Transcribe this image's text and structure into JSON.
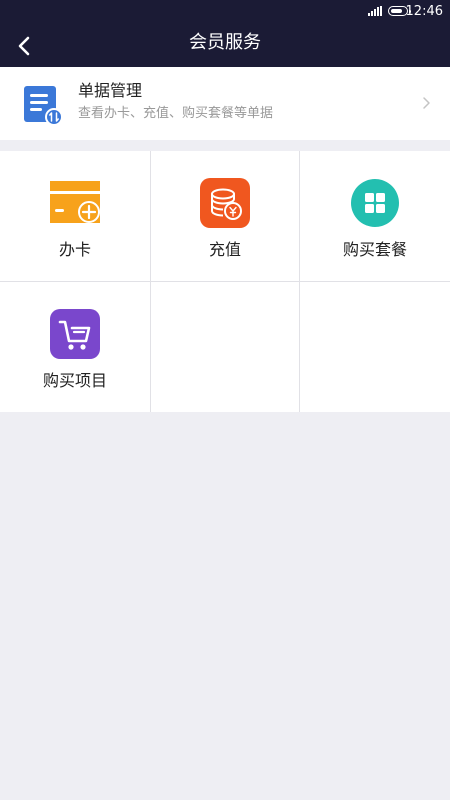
{
  "status_bar": {
    "time": "12:46"
  },
  "nav": {
    "title": "会员服务",
    "back_icon": "chevron-left-icon"
  },
  "doc_entry": {
    "title": "单据管理",
    "subtitle": "查看办卡、充值、购买套餐等单据",
    "icon": "document-icon",
    "chevron_icon": "chevron-right-icon"
  },
  "services": [
    {
      "label": "办卡",
      "icon": "card-add-icon",
      "color": "#f7a21b"
    },
    {
      "label": "充值",
      "icon": "coins-icon",
      "color": "#f0571f"
    },
    {
      "label": "购买套餐",
      "icon": "grid-icon",
      "color": "#23bfb0"
    },
    {
      "label": "购买项目",
      "icon": "cart-icon",
      "color": "#7a47cc"
    }
  ],
  "colors": {
    "header_bg": "#1b1b35",
    "page_bg": "#eeeef3",
    "doc_icon_blue": "#3b78d8"
  }
}
